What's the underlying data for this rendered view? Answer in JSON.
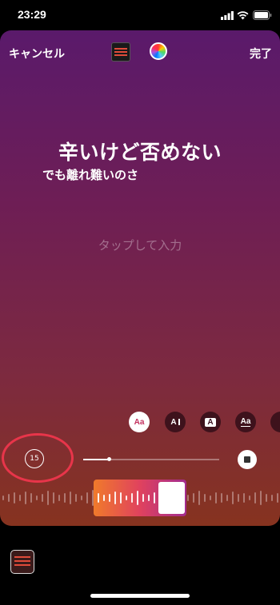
{
  "status_bar": {
    "time": "23:29"
  },
  "header": {
    "cancel_label": "キャンセル",
    "done_label": "完了"
  },
  "lyrics": {
    "line1": "辛いけど否めない",
    "line2": "でも離れ難いのさ"
  },
  "text_input": {
    "placeholder": "タップして入力"
  },
  "style_buttons": [
    "Aa",
    "A",
    "A",
    "Aa"
  ],
  "controls": {
    "duration_label": "15",
    "progress": 0.19
  },
  "colors": {
    "accent_red": "#e8354a",
    "gradient_top": "#5a1a6b",
    "gradient_bottom": "#86331f"
  },
  "icons": [
    "signal-icon",
    "wifi-icon",
    "battery-icon",
    "color-wheel-icon",
    "stop-icon",
    "music-icon"
  ]
}
